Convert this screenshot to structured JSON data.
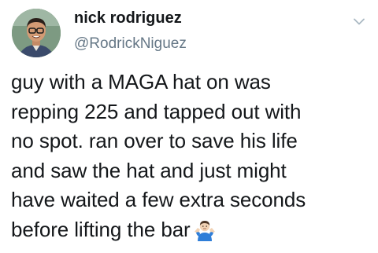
{
  "tweet": {
    "author": {
      "display_name": "nick rodriguez",
      "handle": "@RodrickNiguez",
      "avatar_icon": "profile-photo"
    },
    "menu_icon": "chevron-down-icon",
    "text": "guy with a MAGA hat on was\nrepping 225 and tapped out with\nno spot. ran over to save his life\nand saw the hat and just might\nhave waited a few extra seconds\nbefore lifting the bar",
    "trailing_emoji": "person-shrugging-emoji"
  },
  "colors": {
    "name": "#14171a",
    "handle": "#657786",
    "text": "#14171a",
    "caret": "#aab8c2"
  }
}
